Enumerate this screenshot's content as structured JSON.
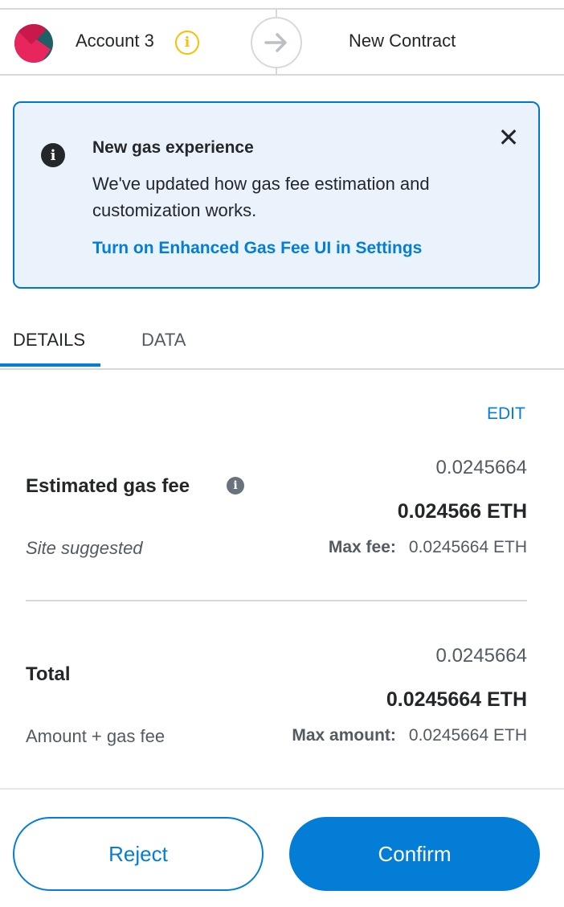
{
  "header": {
    "account_name": "Account 3",
    "contract_label": "New Contract"
  },
  "banner": {
    "title": "New gas experience",
    "body": "We've updated how gas fee estimation and customization works.",
    "link": "Turn on Enhanced Gas Fee UI in Settings",
    "close": "✕"
  },
  "tabs": [
    {
      "label": "DETAILS",
      "active": true
    },
    {
      "label": "DATA",
      "active": false
    }
  ],
  "details": {
    "edit_label": "EDIT",
    "gas_fee": {
      "label": "Estimated gas fee",
      "sub_label": "Site suggested",
      "secondary_value": "0.0245664",
      "primary_value": "0.024566 ETH",
      "max_label": "Max fee:",
      "max_value": "0.0245664 ETH"
    },
    "total": {
      "label": "Total",
      "sub_label": "Amount + gas fee",
      "secondary_value": "0.0245664",
      "primary_value": "0.0245664 ETH",
      "max_label": "Max amount:",
      "max_value": "0.0245664 ETH"
    }
  },
  "footer": {
    "reject_label": "Reject",
    "confirm_label": "Confirm"
  },
  "colors": {
    "accent": "#037dd6",
    "warning": "#f8c000",
    "banner_bg": "#eaf2fb"
  }
}
